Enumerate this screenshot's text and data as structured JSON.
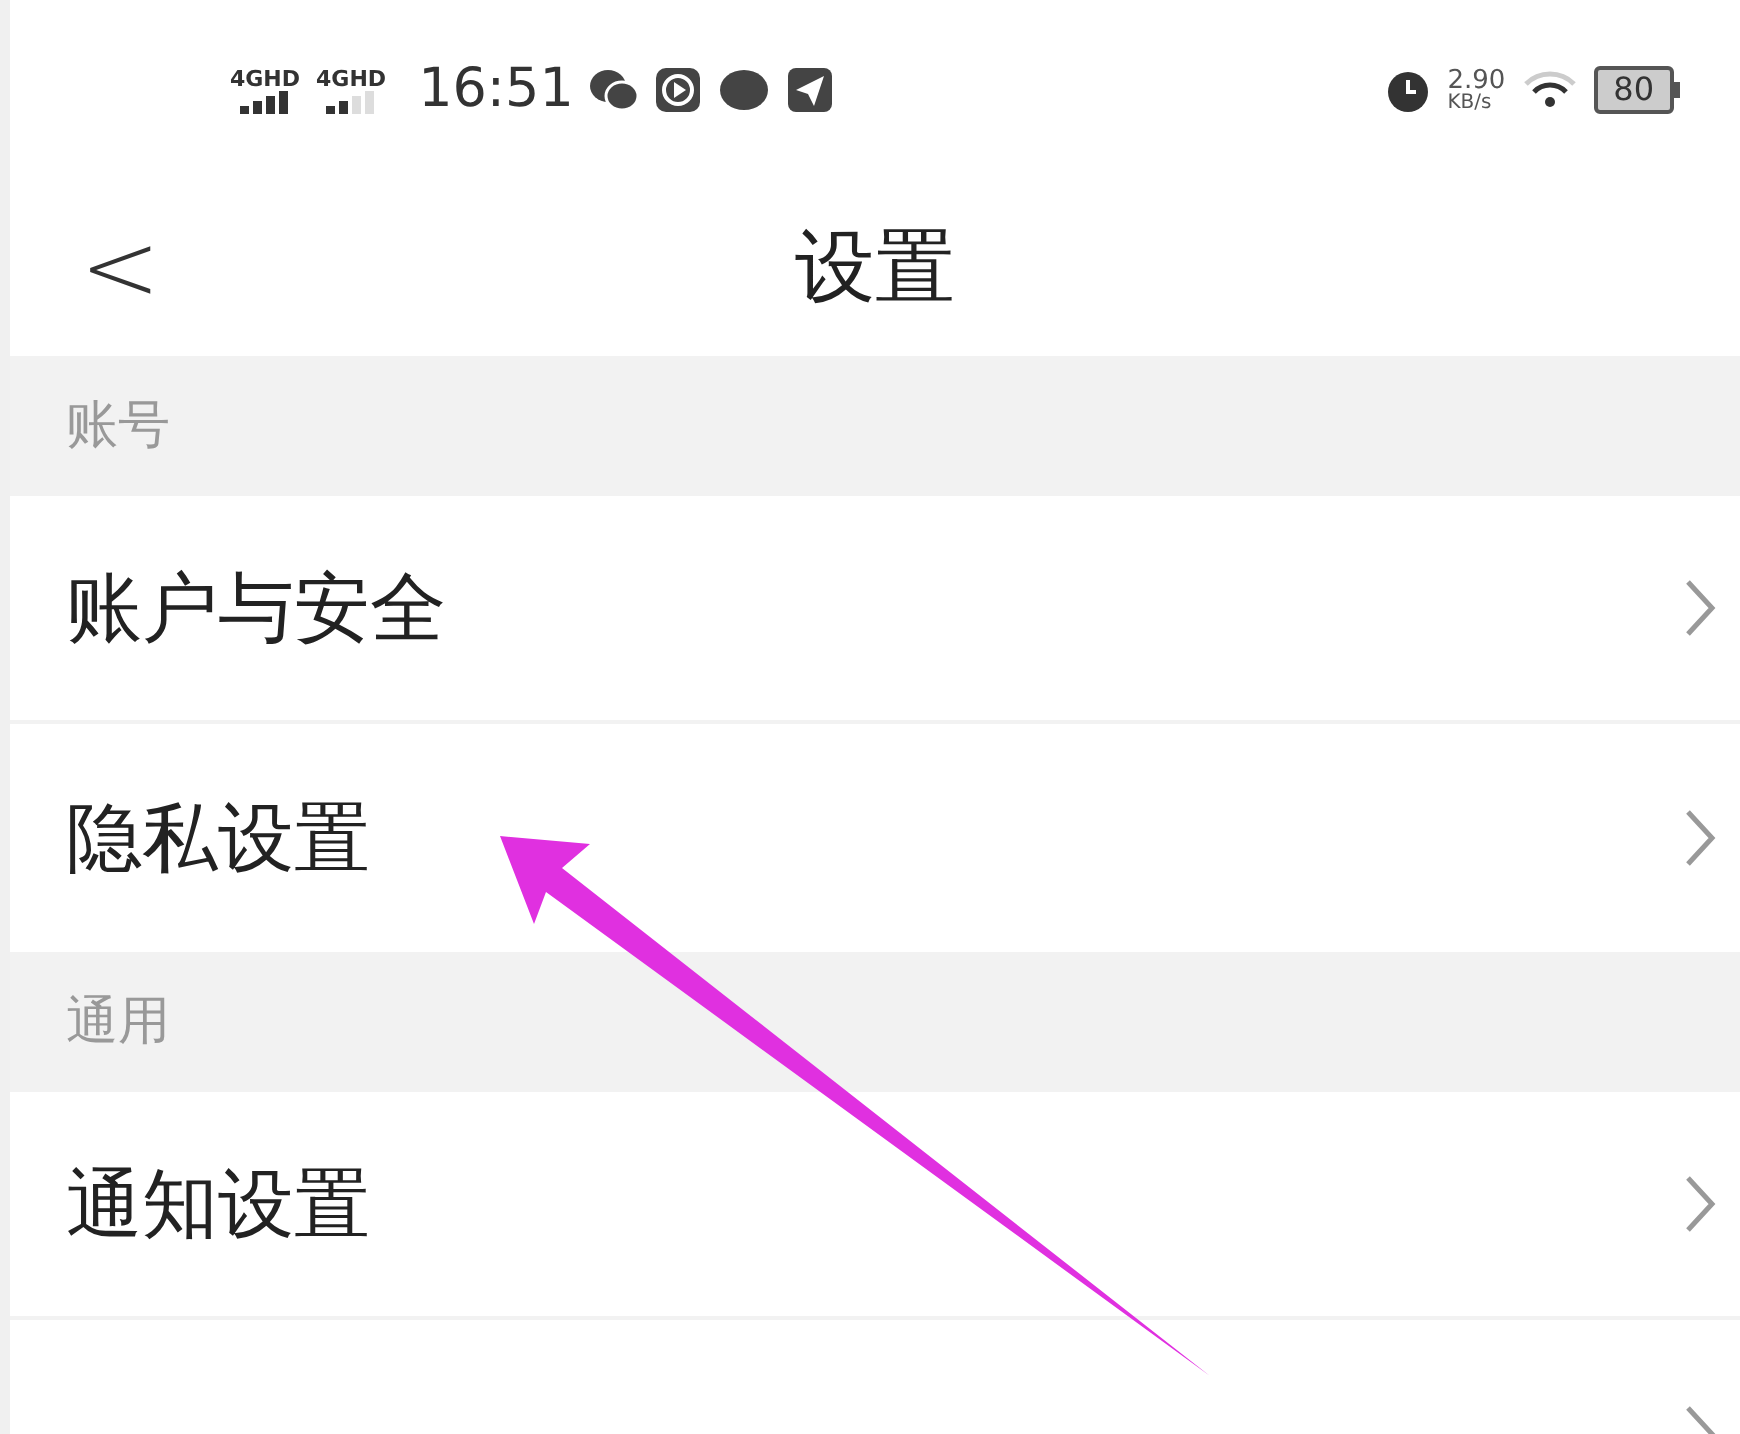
{
  "status_bar": {
    "networks": [
      {
        "label": "4GHD",
        "kind": "strong"
      },
      {
        "label": "4GHD",
        "kind": "weak"
      }
    ],
    "time": "16:51",
    "speed": "2.90",
    "speed_unit": "KB/s",
    "battery": "80"
  },
  "header": {
    "back": "<",
    "title": "设置"
  },
  "sections": [
    {
      "title": "账号",
      "items": [
        {
          "label": "账户与安全",
          "chevron": true
        },
        {
          "label": "隐私设置",
          "chevron": true
        }
      ]
    },
    {
      "title": "通用",
      "items": [
        {
          "label": "通知设置",
          "chevron": true
        },
        {
          "chevron": true
        }
      ]
    }
  ]
}
